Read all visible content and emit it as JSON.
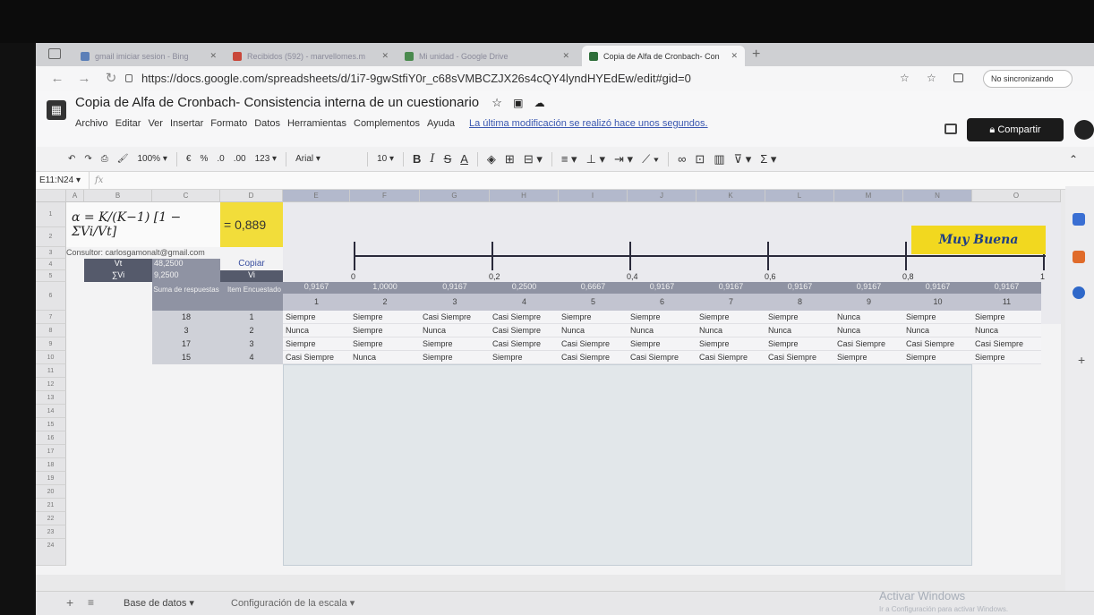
{
  "browser": {
    "tabs": [
      {
        "label": "gmail imiciar sesion - Bing",
        "color": "#5b7fb8"
      },
      {
        "label": "Recibidos (592) - marvellomes.m",
        "color": "#c9473a"
      },
      {
        "label": "Mi unidad - Google Drive",
        "color": "#4a8a4e"
      },
      {
        "label": "Copia de Alfa de Cronbach- Con",
        "color": "#2f6e3a"
      }
    ],
    "url": "https://docs.google.com/spreadsheets/d/1i7-9gwStfiY0r_c68sVMBCZJX26s4cQY4lyndHYEdEw/edit#gid=0",
    "sync_label": "No sincronizando"
  },
  "doc": {
    "title": "Copia de Alfa de Cronbach- Consistencia interna de un cuestionario",
    "menus": [
      "Archivo",
      "Editar",
      "Ver",
      "Insertar",
      "Formato",
      "Datos",
      "Herramientas",
      "Complementos",
      "Ayuda"
    ],
    "last_edit": "La última modificación se realizó hace unos segundos.",
    "share_label": "Compartir"
  },
  "toolbar": {
    "zoom": "100%",
    "currency": "€",
    "percent": "%",
    "dec_less": ".0",
    "dec_more": ".00",
    "format_num": "123",
    "font": "Arial",
    "font_size": "10",
    "bold": "B",
    "italic": "I",
    "strike": "S",
    "text_color": "A"
  },
  "formula_bar": {
    "name_box": "E11:N24",
    "fx": "fx"
  },
  "grid": {
    "columns": [
      "A",
      "B",
      "C",
      "D",
      "E",
      "F",
      "G",
      "H",
      "I",
      "J",
      "K",
      "L",
      "M",
      "N",
      "O"
    ],
    "rows": [
      "1",
      "2",
      "3",
      "4",
      "5",
      "6",
      "7",
      "8",
      "9",
      "10",
      "11",
      "12",
      "13",
      "14",
      "15",
      "16",
      "17",
      "18",
      "19",
      "20",
      "21",
      "22",
      "23",
      "24"
    ],
    "formula_text": "α = K/(K−1) [1 − ΣVi/Vt]",
    "alpha_value": "= 0,889",
    "consultor": "Consultor: carlosgamonalt@gmail.com",
    "vt_label": "Vt",
    "vt_value": "48,2500",
    "copiar_label": "Copiar",
    "svi_label": "∑Vi",
    "svi_value": "9,2500",
    "vi_label": "Vi",
    "suma_label": "Suma de respuestas",
    "item_label": "Item Encuestado",
    "rating": "Muy Buena",
    "scale_ticks": [
      "0",
      "0,2",
      "0,4",
      "0,6",
      "0,8",
      "1"
    ],
    "item_variances": [
      "0,9167",
      "1,0000",
      "0,9167",
      "0,2500",
      "0,6667",
      "0,9167",
      "0,9167",
      "0,9167",
      "0,9167",
      "0,9167",
      "0,9167"
    ],
    "item_numbers": [
      "1",
      "2",
      "3",
      "4",
      "5",
      "6",
      "7",
      "8",
      "9",
      "10",
      "11"
    ],
    "responses": [
      {
        "suma": "18",
        "item": "1",
        "answers": [
          "Siempre",
          "Siempre",
          "Casi Siempre",
          "Casi Siempre",
          "Siempre",
          "Siempre",
          "Siempre",
          "Siempre",
          "Nunca",
          "Siempre",
          "Siempre"
        ]
      },
      {
        "suma": "3",
        "item": "2",
        "answers": [
          "Nunca",
          "Siempre",
          "Nunca",
          "Casi Siempre",
          "Nunca",
          "Nunca",
          "Nunca",
          "Nunca",
          "Nunca",
          "Nunca",
          "Nunca"
        ]
      },
      {
        "suma": "17",
        "item": "3",
        "answers": [
          "Siempre",
          "Siempre",
          "Siempre",
          "Casi Siempre",
          "Casi Siempre",
          "Siempre",
          "Siempre",
          "Siempre",
          "Casi Siempre",
          "Casi Siempre",
          "Casi Siempre"
        ]
      },
      {
        "suma": "15",
        "item": "4",
        "answers": [
          "Casi Siempre",
          "Nunca",
          "Siempre",
          "Siempre",
          "Casi Siempre",
          "Casi Siempre",
          "Casi Siempre",
          "Casi Siempre",
          "Siempre",
          "Siempre",
          "Siempre"
        ]
      }
    ]
  },
  "sheet_tabs": [
    "Base de datos",
    "Configuración de la escala"
  ],
  "watermark": {
    "line1": "Activar Windows",
    "line2": "Ir a Configuración para activar Windows."
  }
}
